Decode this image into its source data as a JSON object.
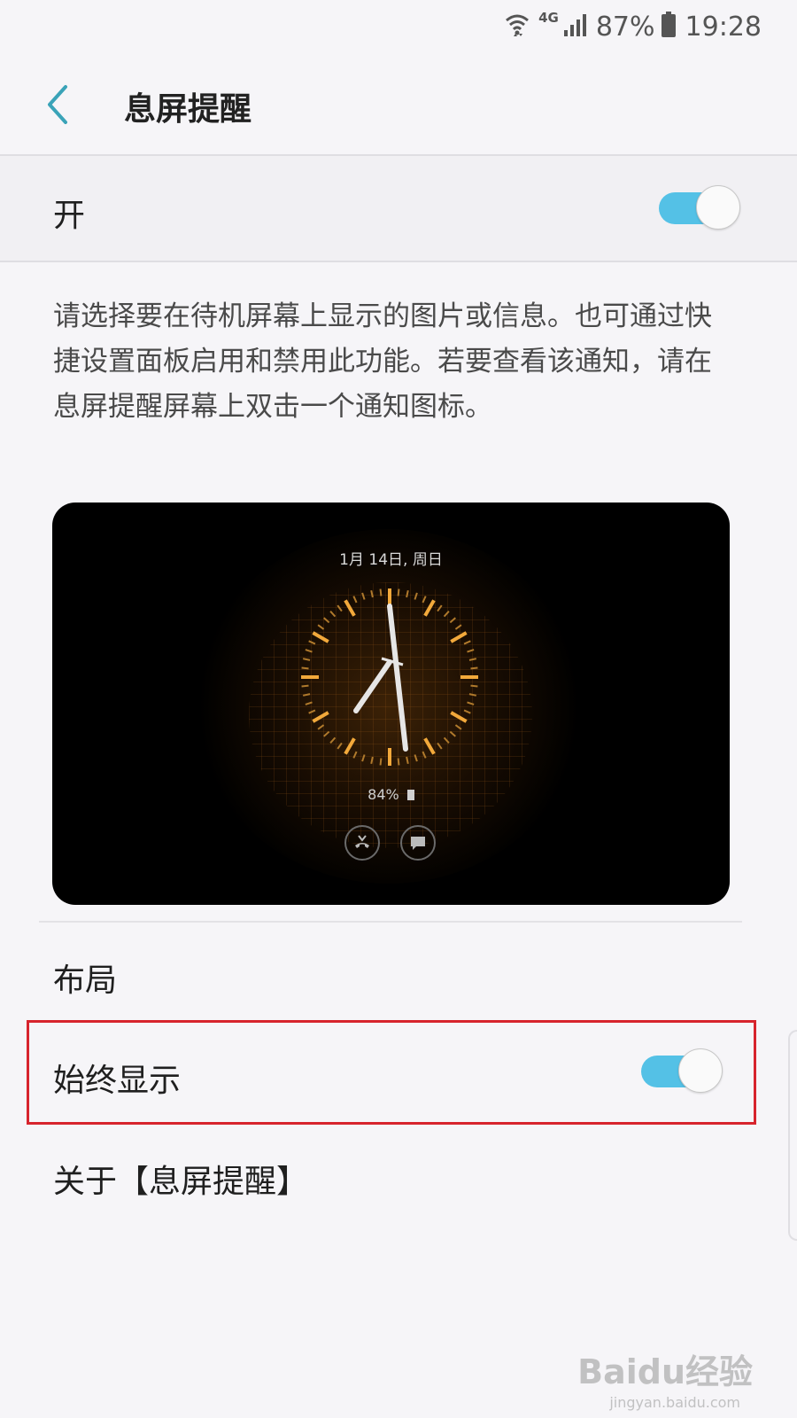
{
  "status_bar": {
    "network": "4G",
    "battery": "87%",
    "time": "19:28",
    "icons": [
      "wifi-icon",
      "signal-icon",
      "battery-icon"
    ]
  },
  "header": {
    "title": "息屏提醒",
    "back_icon": "chevron-left-icon"
  },
  "master_switch": {
    "label": "开",
    "on": true
  },
  "description": "请选择要在待机屏幕上显示的图片或信息。也可通过快捷设置面板启用和禁用此功能。若要查看该通知，请在息屏提醒屏幕上双击一个通知图标。",
  "preview": {
    "date": "1月 14日, 周日",
    "battery": "84%",
    "accent": "#f2a93b",
    "icons": [
      "missed-call-icon",
      "message-icon"
    ]
  },
  "list": {
    "layout_label": "布局",
    "always_on_label": "始终显示",
    "always_on": true,
    "about_label": "关于【息屏提醒】"
  },
  "watermark": {
    "brand": "Baidu经验",
    "url": "jingyan.baidu.com"
  },
  "colors": {
    "toggle_on": "#54c1e6",
    "back_arrow": "#3aa3b8",
    "highlight": "#d7242d"
  }
}
